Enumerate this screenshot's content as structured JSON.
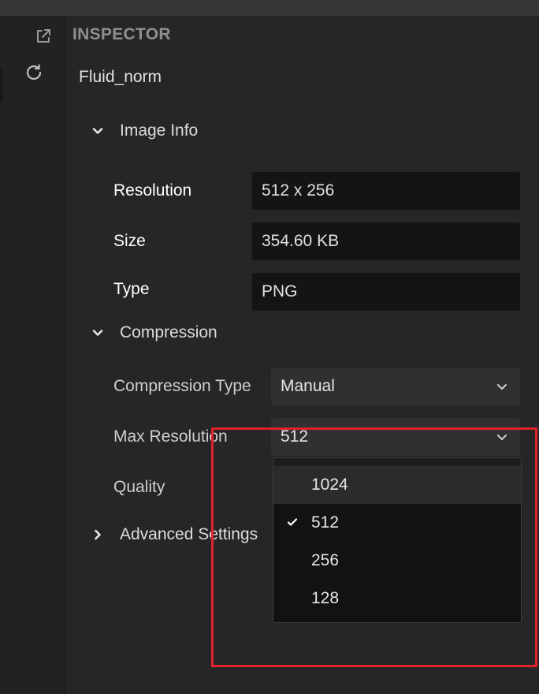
{
  "panel": {
    "title": "INSPECTOR",
    "asset_name": "Fluid_norm"
  },
  "rail": {
    "icons": [
      "external-link-icon",
      "refresh-icon"
    ]
  },
  "sections": {
    "image_info": {
      "label": "Image Info",
      "expanded": true,
      "resolution_label": "Resolution",
      "resolution_value": "512 x 256",
      "size_label": "Size",
      "size_value": "354.60 KB",
      "type_label": "Type",
      "type_value": "PNG"
    },
    "compression": {
      "label": "Compression",
      "expanded": true,
      "compression_type_label": "Compression Type",
      "compression_type_value": "Manual",
      "max_resolution_label": "Max Resolution",
      "max_resolution_value": "512",
      "quality_label": "Quality"
    },
    "advanced": {
      "label": "Advanced Settings",
      "expanded": false
    }
  },
  "dropdown": {
    "options": [
      {
        "label": "1024",
        "selected": false,
        "hovered": true
      },
      {
        "label": "512",
        "selected": true,
        "hovered": false
      },
      {
        "label": "256",
        "selected": false,
        "hovered": false
      },
      {
        "label": "128",
        "selected": false,
        "hovered": false
      }
    ]
  },
  "colors": {
    "highlight": "#e0232b",
    "panel_bg": "#262626",
    "field_bg": "#141414"
  }
}
